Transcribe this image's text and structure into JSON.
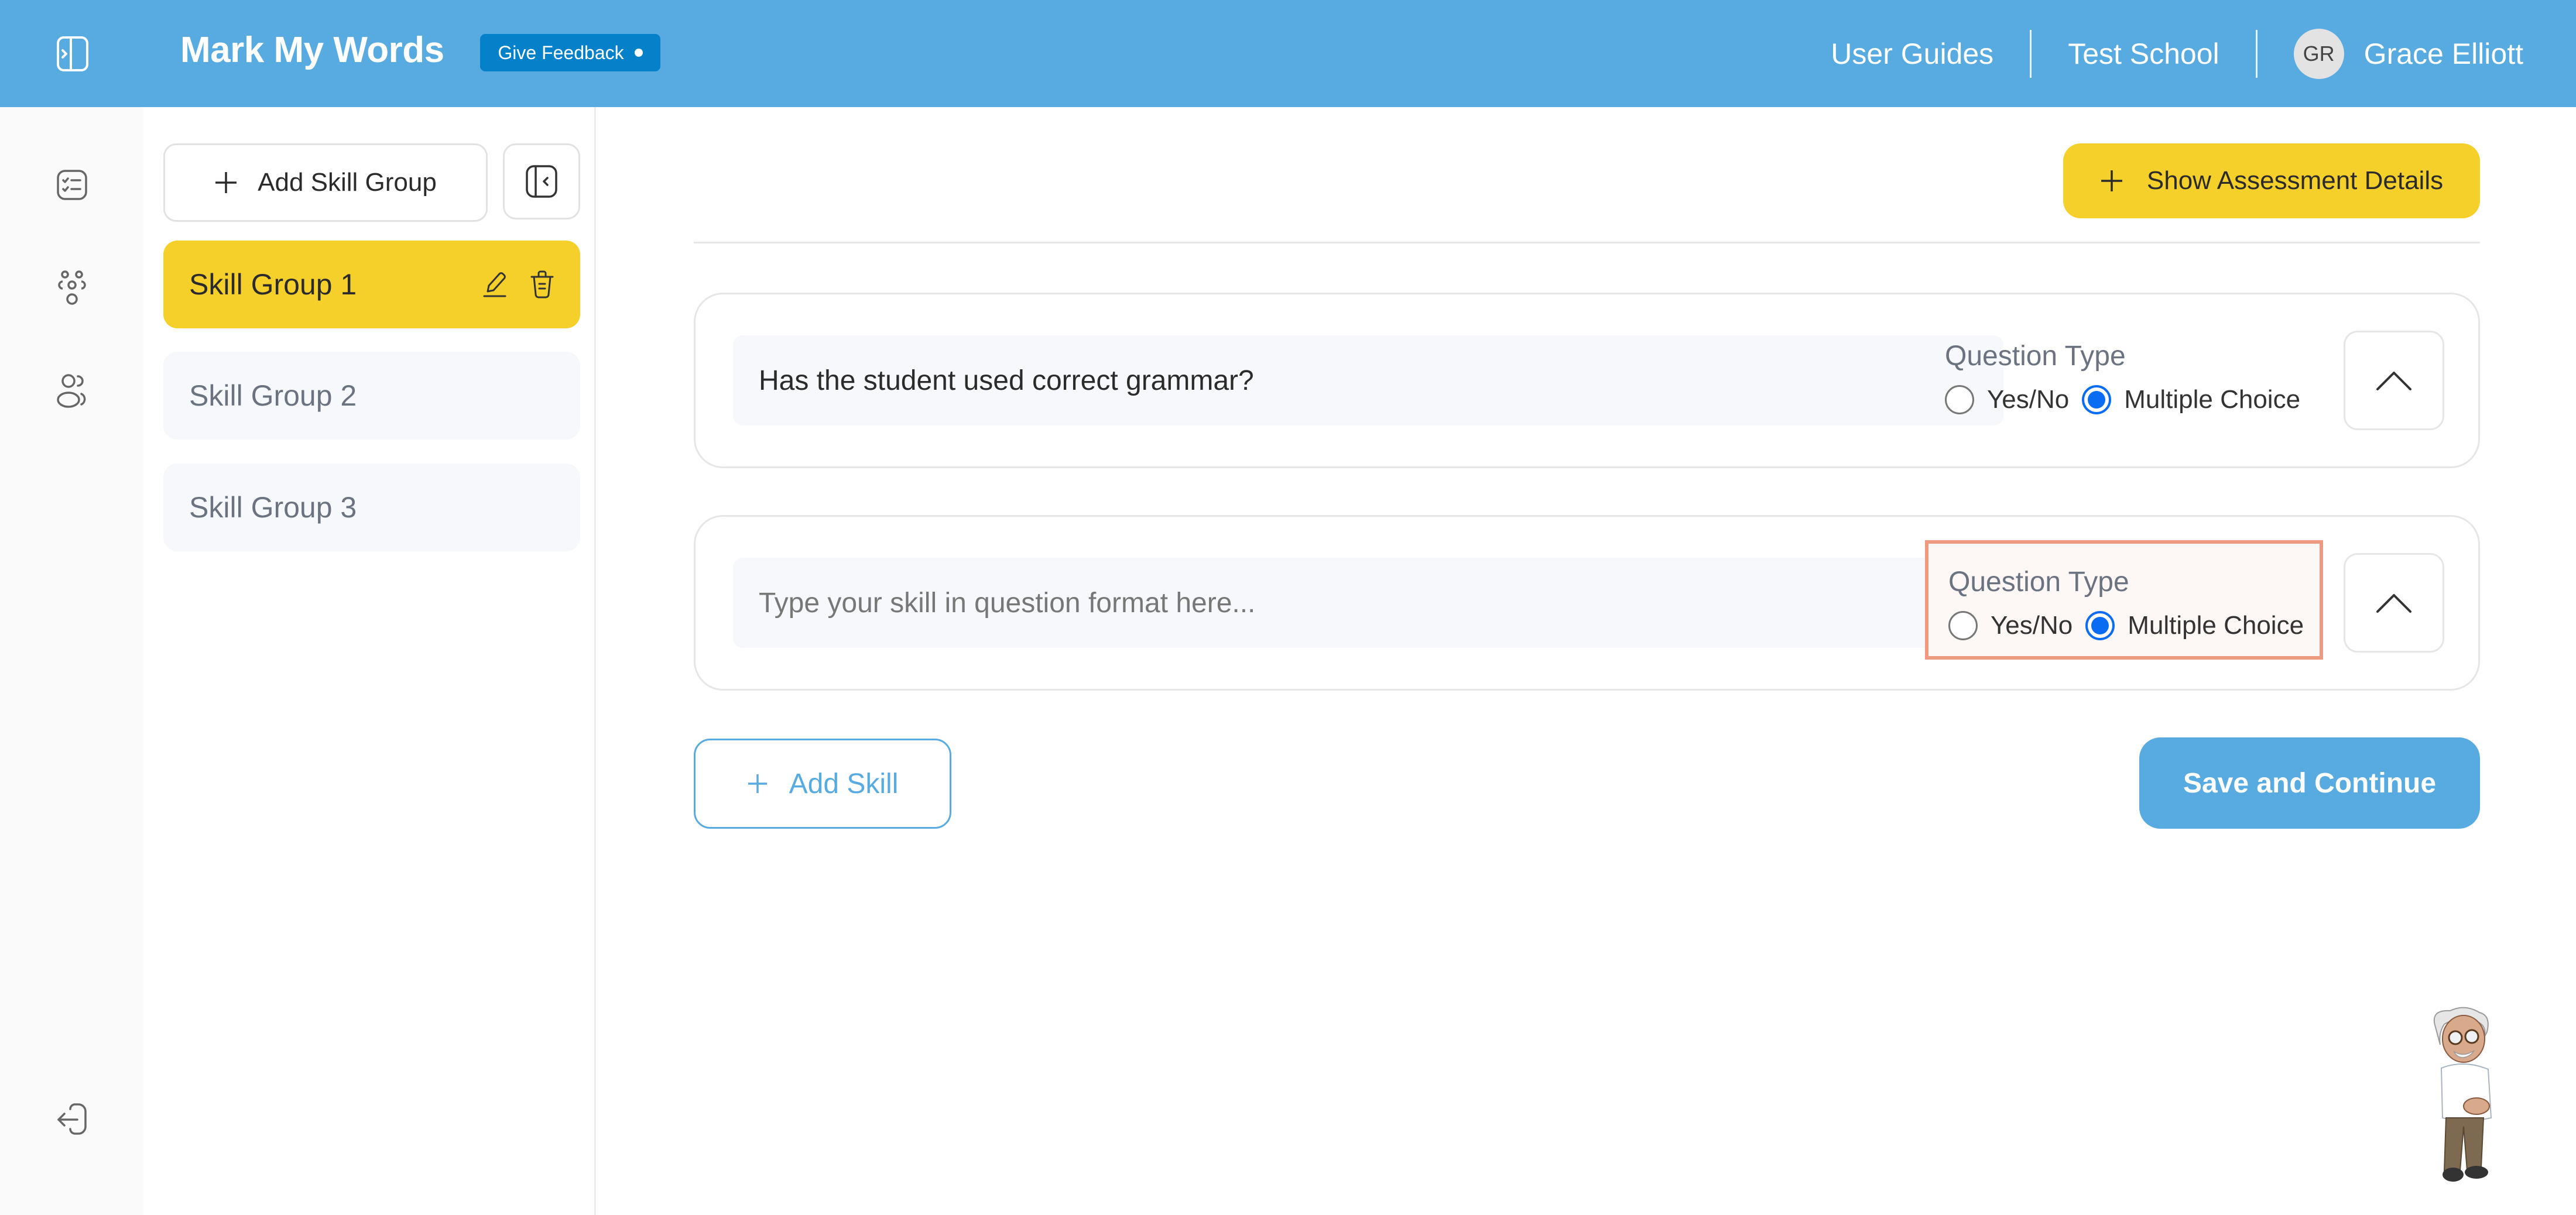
{
  "header": {
    "app_title": "Mark My Words",
    "feedback_label": "Give Feedback",
    "links": [
      "User Guides",
      "Test School"
    ],
    "user": {
      "initials": "GR",
      "name": "Grace Elliott"
    }
  },
  "rail": {
    "icons": [
      "checklist-icon",
      "group-icon",
      "users-icon"
    ],
    "bottom_icon": "logout-icon"
  },
  "skill_groups_panel": {
    "add_label": "Add Skill Group",
    "groups": [
      {
        "label": "Skill Group 1",
        "active": true
      },
      {
        "label": "Skill Group 2",
        "active": false
      },
      {
        "label": "Skill Group 3",
        "active": false
      }
    ]
  },
  "main": {
    "show_details_label": "Show Assessment Details",
    "skills": [
      {
        "value": "Has the student used correct grammar?",
        "placeholder": "Type your skill in question format here...",
        "question_type_label": "Question Type",
        "options": [
          "Yes/No",
          "Multiple Choice"
        ],
        "selected": "Multiple Choice",
        "highlighted": false
      },
      {
        "value": "",
        "placeholder": "Type your skill in question format here...",
        "question_type_label": "Question Type",
        "options": [
          "Yes/No",
          "Multiple Choice"
        ],
        "selected": "Multiple Choice",
        "highlighted": true
      }
    ],
    "add_skill_label": "Add Skill",
    "save_label": "Save and Continue"
  },
  "colors": {
    "brand_blue": "#57abe0",
    "feedback_blue": "#0581c9",
    "accent_yellow": "#f5d02a",
    "radio_blue": "#0a6cf2",
    "highlight_border": "#ee9a80"
  }
}
